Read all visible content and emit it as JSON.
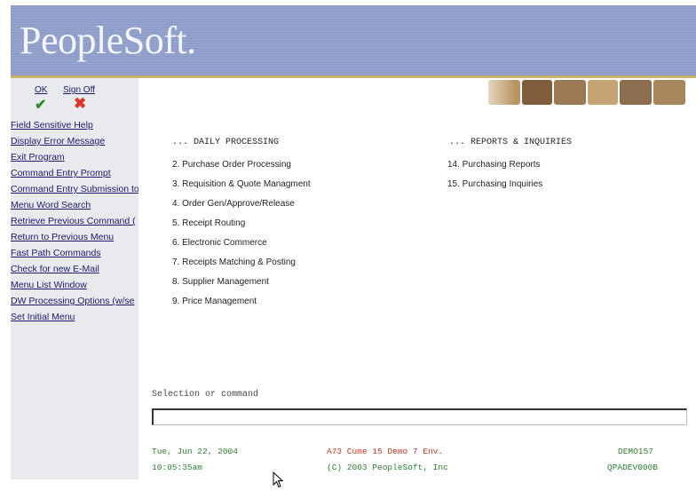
{
  "header": {
    "logo_text": "PeopleSoft."
  },
  "sidebar": {
    "ok_label": "OK",
    "signoff_label": "Sign Off",
    "links": [
      "Field Sensitive Help",
      "Display Error Message",
      "Exit Program",
      "Command Entry Prompt",
      "Command Entry Submission to",
      "Menu Word Search",
      "Retrieve Previous Command (",
      "Return to Previous Menu",
      "Fast Path Commands",
      "Check for new E-Mail",
      "Menu List Window",
      "DW Processing Options (w/se",
      "Set Initial Menu"
    ]
  },
  "menu": {
    "daily_heading": "... DAILY PROCESSING",
    "reports_heading": "... REPORTS & INQUIRIES",
    "daily_items": [
      "2. Purchase Order Processing",
      "3. Requisition & Quote Managment",
      "4. Order Gen/Approve/Release",
      "5. Receipt Routing",
      "6. Electronic Commerce",
      "7. Receipts Matching & Posting",
      "8. Supplier Management",
      "9. Price Management"
    ],
    "report_items": [
      "14. Purchasing Reports",
      "15. Purchasing Inquiries"
    ]
  },
  "command": {
    "label": "Selection or command",
    "value": ""
  },
  "footer": {
    "date": "Tue, Jun 22, 2004",
    "time": "10:05:35am",
    "env": "A73 Cume 15 Demo 7 Env.",
    "copyright": "(C) 2003 PeopleSoft, Inc",
    "user": "DEMO157",
    "screen": "QPADEV000B"
  },
  "colors": {
    "banner": "#8b9ac6",
    "sidebar": "#e9eaee",
    "link": "#1a1a6e",
    "green": "#2e7d32",
    "red": "#c0392b"
  }
}
